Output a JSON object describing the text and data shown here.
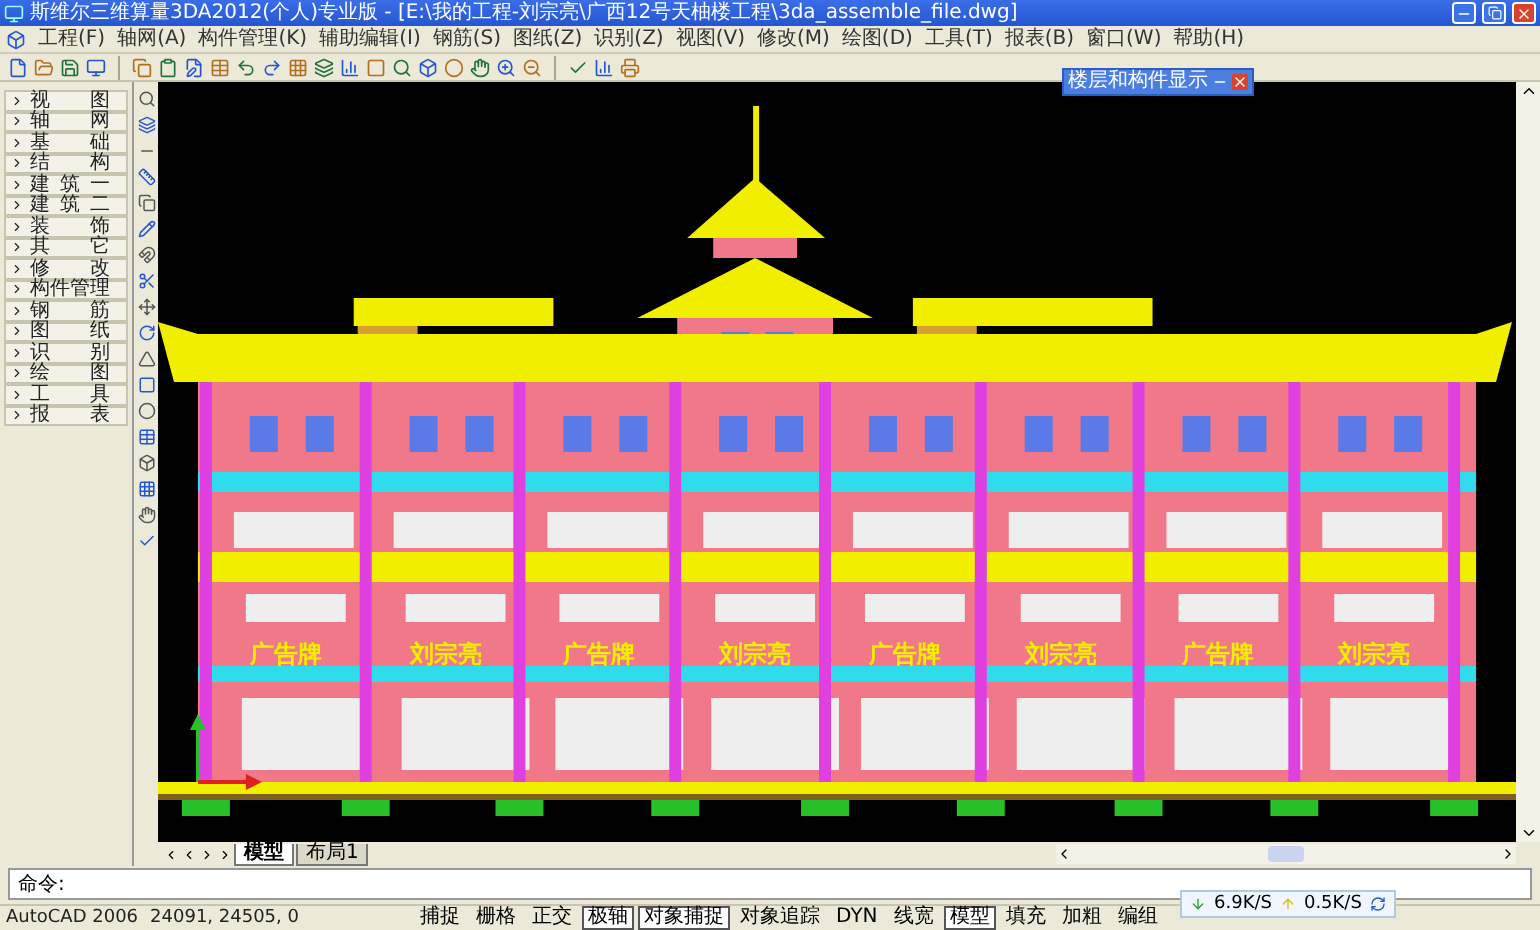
{
  "window": {
    "title": "斯维尔三维算量3DA2012(个人)专业版 - [E:\\我的工程-刘宗亮\\广西12号天柚楼工程\\3da_assemble_file.dwg]"
  },
  "menu": [
    "工程(F)",
    "轴网(A)",
    "构件管理(K)",
    "辅助编辑(I)",
    "钢筋(S)",
    "图纸(Z)",
    "识别(Z)",
    "视图(V)",
    "修改(M)",
    "绘图(D)",
    "工具(T)",
    "报表(B)",
    "窗口(W)",
    "帮助(H)"
  ],
  "sidebar": {
    "items": [
      "视图",
      "轴网",
      "基础",
      "结构",
      "建筑一",
      "建筑二",
      "装饰",
      "其它",
      "修改",
      "构件管理",
      "钢筋",
      "图纸",
      "识别",
      "绘图",
      "工具",
      "报表"
    ]
  },
  "floating_panel": {
    "title": "楼层和构件显示"
  },
  "signs": [
    "广告牌",
    "刘宗亮",
    "广告牌",
    "刘宗亮",
    "广告牌",
    "刘宗亮",
    "广告牌",
    "刘宗亮"
  ],
  "tabs": [
    {
      "label": "模型",
      "selected": true
    },
    {
      "label": "布局1",
      "selected": false
    }
  ],
  "command": {
    "prompt": "命令:"
  },
  "status_bar": {
    "app": "AutoCAD 2006",
    "coordinates": "24091,  24505, 0",
    "toggles": [
      {
        "label": "捕捉",
        "on": false
      },
      {
        "label": "栅格",
        "on": false
      },
      {
        "label": "正交",
        "on": false
      },
      {
        "label": "极轴",
        "on": true
      },
      {
        "label": "对象捕捉",
        "on": true
      },
      {
        "label": "对象追踪",
        "on": false
      },
      {
        "label": "DYN",
        "on": false
      },
      {
        "label": "线宽",
        "on": false
      },
      {
        "label": "模型",
        "on": true
      }
    ],
    "extras": [
      "填充",
      "加粗",
      "编组"
    ]
  },
  "network": {
    "download": "6.9K/S",
    "upload": "0.5K/S"
  }
}
